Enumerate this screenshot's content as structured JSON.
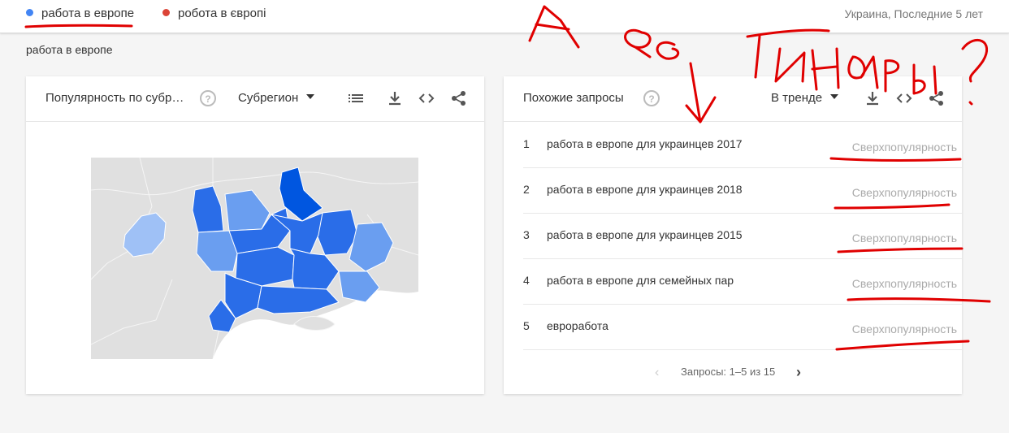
{
  "header": {
    "term1": {
      "label": "работа в европе",
      "color": "#4285f4"
    },
    "term2": {
      "label": "робота в європі",
      "color": "#db4437"
    },
    "region_period": "Украина, Последние 5 лет"
  },
  "subtitle": "работа в европе",
  "region_card": {
    "title": "Популярность по субр…",
    "help_icon": "help-circle-icon",
    "select_label": "Субрегион",
    "map_colors": {
      "high": "#0056e0",
      "mid": "#2a6de8",
      "low": "#6a9ef0",
      "lowest": "#9fc1f6",
      "empty": "#e0e0e0"
    }
  },
  "queries_card": {
    "title": "Похожие запросы",
    "select_label": "В тренде",
    "rows": [
      {
        "rank": "1",
        "query": "работа в европе для украинцев 2017",
        "value": "Сверхпопулярность"
      },
      {
        "rank": "2",
        "query": "работа в европе для украинцев 2018",
        "value": "Сверхпопулярность"
      },
      {
        "rank": "3",
        "query": "работа в европе для украинцев 2015",
        "value": "Сверхпопулярность"
      },
      {
        "rank": "4",
        "query": "работа в европе для семейных пар",
        "value": "Сверхпопулярность"
      },
      {
        "rank": "5",
        "query": "евроработа",
        "value": "Сверхпопулярность"
      }
    ],
    "pager_text": "Запросы: 1–5 из 15"
  },
  "annotation": {
    "color": "#e00000"
  }
}
